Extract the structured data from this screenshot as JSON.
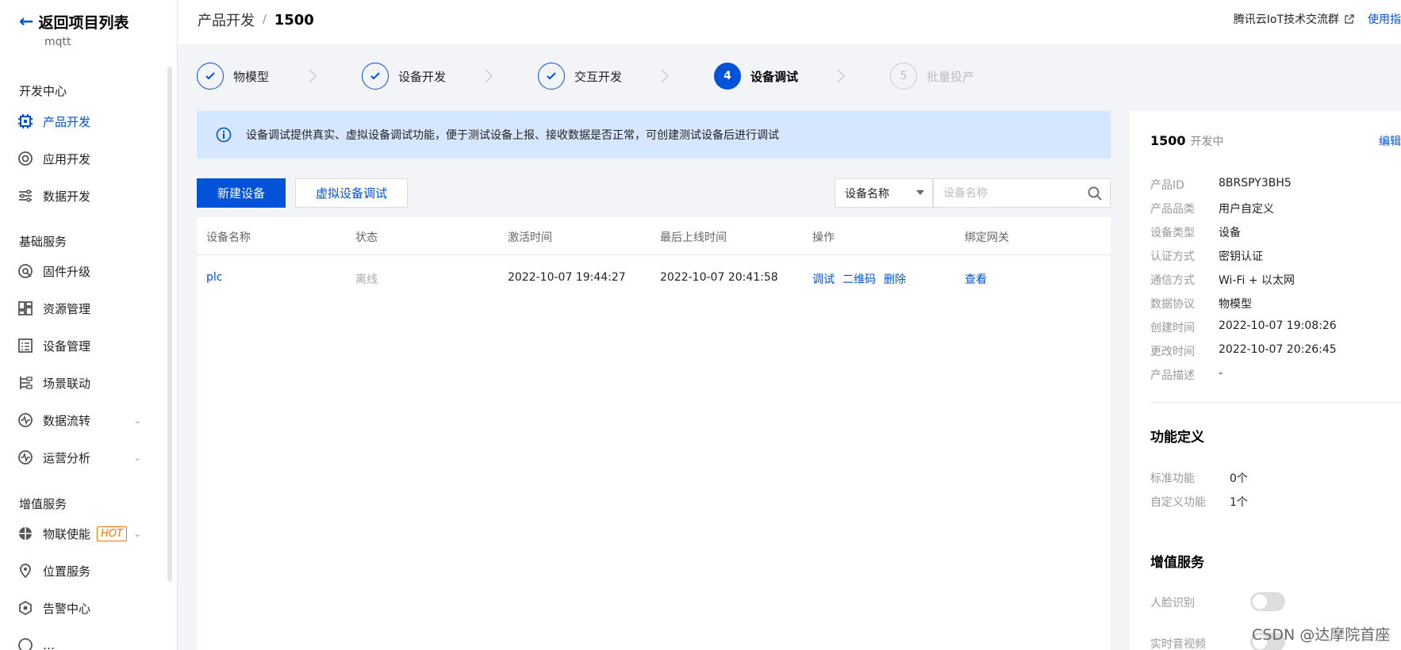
{
  "sidebar": {
    "back_label": "返回项目列表",
    "project_name": "mqtt",
    "sections": {
      "dev_center": "开发中心",
      "basic": "基础服务",
      "value_added": "增值服务"
    },
    "items": {
      "product_dev": "产品开发",
      "app_dev": "应用开发",
      "data_dev": "数据开发",
      "firmware": "固件升级",
      "resources": "资源管理",
      "devices": "设备管理",
      "scenes": "场景联动",
      "data_flow": "数据流转",
      "ops_analysis": "运营分析",
      "iot_enable": "物联使能",
      "location": "位置服务",
      "alarm": "告警中心",
      "partial": "…"
    },
    "hot_badge": "HOT"
  },
  "topbar": {
    "breadcrumb_root": "产品开发",
    "breadcrumb_sep": "/",
    "breadcrumb_current": "1500",
    "community_link": "腾讯云IoT技术交流群",
    "guide_link": "使用指"
  },
  "steps": [
    {
      "label": "物模型",
      "state": "done"
    },
    {
      "label": "设备开发",
      "state": "done"
    },
    {
      "label": "交互开发",
      "state": "done"
    },
    {
      "label": "设备调试",
      "state": "current",
      "number": "4"
    },
    {
      "label": "批量投产",
      "state": "todo",
      "number": "5"
    }
  ],
  "banner": {
    "text": "设备调试提供真实、虚拟设备调试功能，便于测试设备上报、接收数据是否正常，可创建测试设备后进行调试"
  },
  "toolbar": {
    "new_device": "新建设备",
    "virtual_debug": "虚拟设备调试",
    "filter_selected": "设备名称",
    "search_placeholder": "设备名称"
  },
  "table": {
    "columns": [
      "设备名称",
      "状态",
      "激活时间",
      "最后上线时间",
      "操作",
      "绑定网关"
    ],
    "rows": [
      {
        "name": "plc",
        "status": "离线",
        "activated": "2022-10-07 19:44:27",
        "last_online": "2022-10-07 20:41:58",
        "ops": [
          "调试",
          "二维码",
          "删除"
        ],
        "gateway": "查看"
      }
    ]
  },
  "panel": {
    "product_name": "1500",
    "status": "开发中",
    "edit": "编辑",
    "info": [
      {
        "k": "产品ID",
        "v": "8BRSPY3BH5"
      },
      {
        "k": "产品品类",
        "v": "用户自定义"
      },
      {
        "k": "设备类型",
        "v": "设备"
      },
      {
        "k": "认证方式",
        "v": "密钥认证"
      },
      {
        "k": "通信方式",
        "v": "Wi-Fi + 以太网"
      },
      {
        "k": "数据协议",
        "v": "物模型"
      },
      {
        "k": "创建时间",
        "v": "2022-10-07 19:08:26"
      },
      {
        "k": "更改时间",
        "v": "2022-10-07 20:26:45"
      },
      {
        "k": "产品描述",
        "v": "-"
      }
    ],
    "func_title": "功能定义",
    "func": [
      {
        "k": "标准功能",
        "v": "0个"
      },
      {
        "k": "自定义功能",
        "v": "1个"
      }
    ],
    "vas_title": "增值服务",
    "vas": [
      {
        "k": "人脸识别",
        "enabled": false
      },
      {
        "k": "实时音视频",
        "enabled": false
      }
    ]
  },
  "watermark": "CSDN @达摩院首座",
  "colors": {
    "accent": "#0052d9",
    "banner_bg": "#d5e7ff",
    "hot": "#ff7200"
  }
}
